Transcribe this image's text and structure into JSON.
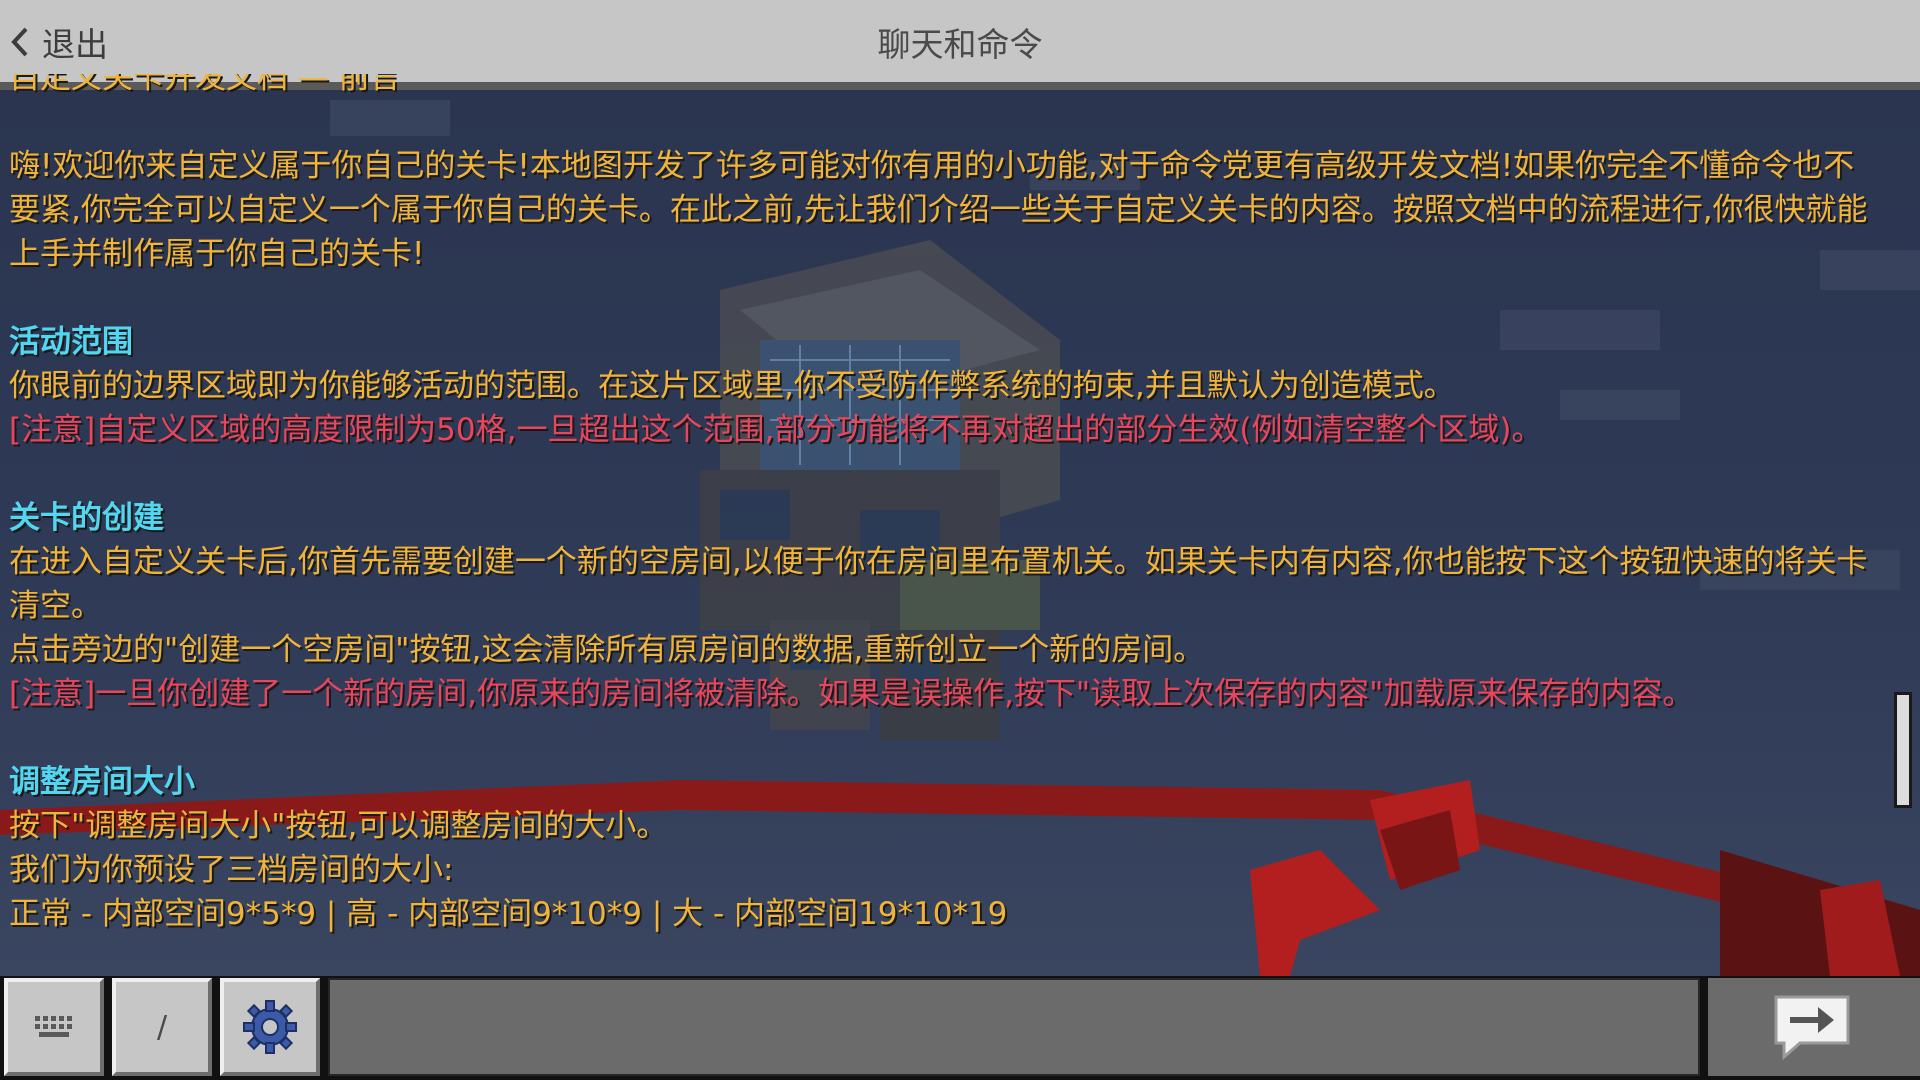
{
  "header": {
    "back_label": "退出",
    "title": "聊天和命令"
  },
  "chat": {
    "cut_line": "自定义关卡开发文档 — 前言",
    "intro": "嗨!欢迎你来自定义属于你自己的关卡!本地图开发了许多可能对你有用的小功能,对于命令党更有高级开发文档!如果你完全不懂命令也不要紧,你完全可以自定义一个属于你自己的关卡。在此之前,先让我们介绍一些关于自定义关卡的内容。按照文档中的流程进行,你很快就能上手并制作属于你自己的关卡!",
    "sections": [
      {
        "heading": "活动范围",
        "lines": [
          {
            "style": "gold",
            "text": "你眼前的边界区域即为你能够活动的范围。在这片区域里,你不受防作弊系统的拘束,并且默认为创造模式。"
          },
          {
            "style": "red",
            "text": "[注意]自定义区域的高度限制为50格,一旦超出这个范围,部分功能将不再对超出的部分生效(例如清空整个区域)。"
          }
        ]
      },
      {
        "heading": "关卡的创建",
        "lines": [
          {
            "style": "gold",
            "text": "在进入自定义关卡后,你首先需要创建一个新的空房间,以便于你在房间里布置机关。如果关卡内有内容,你也能按下这个按钮快速的将关卡清空。"
          },
          {
            "style": "gold",
            "text": "点击旁边的\"创建一个空房间\"按钮,这会清除所有原房间的数据,重新创立一个新的房间。"
          },
          {
            "style": "red",
            "text": "[注意]一旦你创建了一个新的房间,你原来的房间将被清除。如果是误操作,按下\"读取上次保存的内容\"加载原来保存的内容。"
          }
        ]
      },
      {
        "heading": "调整房间大小",
        "lines": [
          {
            "style": "gold",
            "text": "按下\"调整房间大小\"按钮,可以调整房间的大小。"
          },
          {
            "style": "gold",
            "text": "我们为你预设了三档房间的大小:"
          },
          {
            "style": "gold",
            "text": "正常 - 内部空间9*5*9 | 高 - 内部空间9*10*9 | 大 - 内部空间19*10*19"
          }
        ]
      }
    ]
  },
  "bottom": {
    "keyboard_icon": "keyboard-icon",
    "slash_label": "/",
    "settings_icon": "gear-icon",
    "input_value": "",
    "input_placeholder": "",
    "send_icon": "send-arrow-icon"
  },
  "colors": {
    "gold": "#f0b43a",
    "aqua": "#53d6f2",
    "red": "#e8455e",
    "topbar": "#c6c6c6"
  }
}
